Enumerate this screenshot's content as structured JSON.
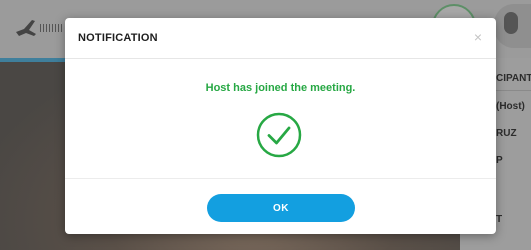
{
  "background": {
    "sidebar": {
      "header_fragment": "CIPANTS",
      "item_1_fragment": "(Host)",
      "item_2_fragment": "RUZ",
      "item_3_fragment": "P",
      "item_4_fragment": "T"
    }
  },
  "modal": {
    "title": "NOTIFICATION",
    "close_glyph": "×",
    "message": "Host has joined the meeting.",
    "ok_label": "OK"
  },
  "colors": {
    "accent": "#139fe0",
    "success": "#27a844"
  },
  "icons": {
    "success": "check-circle-icon",
    "close": "close-icon",
    "muted": "plane-icon",
    "mic": "microphone-icon"
  }
}
